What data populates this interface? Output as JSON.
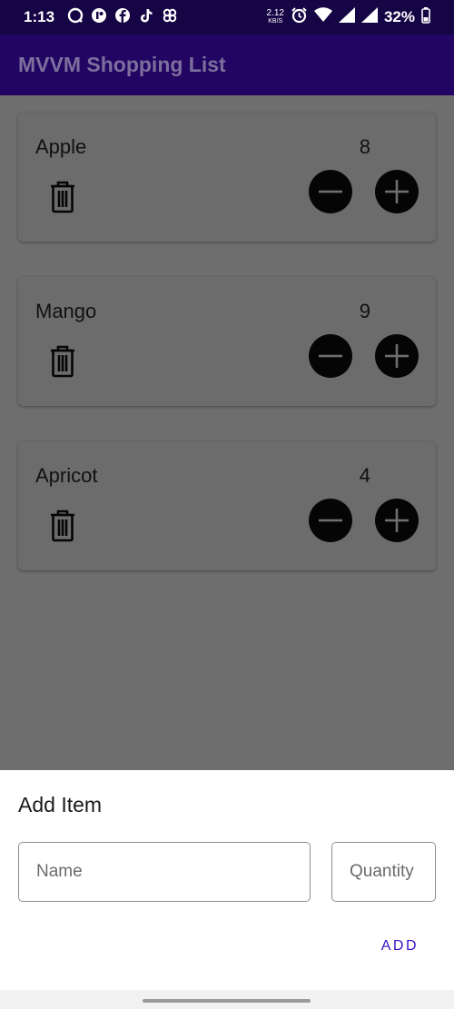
{
  "status_bar": {
    "time": "1:13",
    "net_speed_value": "2.12",
    "net_speed_unit": "KB/S",
    "battery": "32%",
    "icons": [
      "o-notification-icon",
      "fb-messenger-icon",
      "facebook-icon",
      "tiktok-icon",
      "pinwheel-icon",
      "alarm-icon",
      "wifi-icon",
      "signal-icon",
      "signal-2-icon",
      "battery-icon"
    ]
  },
  "app_bar": {
    "title": "MVVM Shopping List"
  },
  "items": [
    {
      "name": "Apple",
      "quantity": "8"
    },
    {
      "name": "Mango",
      "quantity": "9"
    },
    {
      "name": "Apricot",
      "quantity": "4"
    }
  ],
  "dialog": {
    "title": "Add Item",
    "name_placeholder": "Name",
    "name_value": "",
    "quantity_placeholder": "Quantity",
    "quantity_value": "",
    "add_label": "ADD"
  },
  "colors": {
    "status_bar": "#160545",
    "app_bar": "#220563",
    "scrim": "#6e6e6e",
    "accent": "#3a12c4"
  }
}
